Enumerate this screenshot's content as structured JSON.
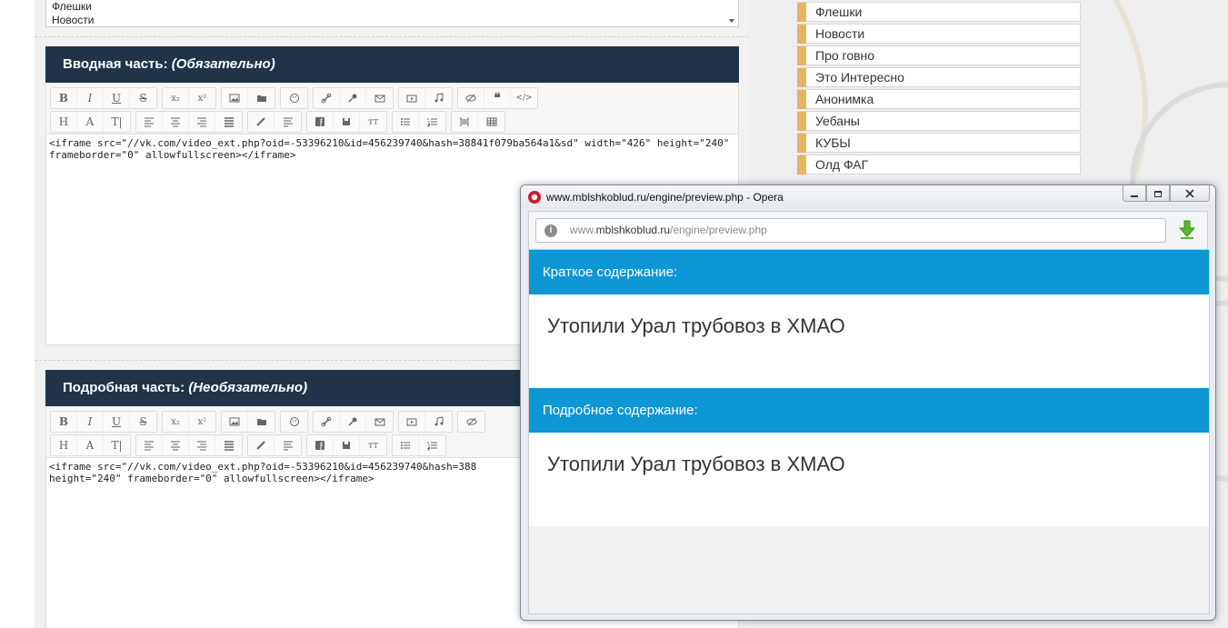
{
  "top_select": {
    "options": [
      "Флешки",
      "Новости"
    ]
  },
  "section_intro": {
    "title": "Вводная часть:",
    "required": "(Обязательно)",
    "editor_text": "<iframe src=\"//vk.com/video_ext.php?oid=-53396210&id=456239740&hash=38841f079ba564a1&sd\" width=\"426\" height=\"240\" frameborder=\"0\" allowfullscreen></iframe>"
  },
  "section_detail": {
    "title": "Подробная часть:",
    "required": "(Необязательно)",
    "editor_text": "<iframe src=\"//vk.com/video_ext.php?oid=-53396210&id=456239740&hash=388\nheight=\"240\" frameborder=\"0\" allowfullscreen></iframe>"
  },
  "toolbar": {
    "row1": [
      "B",
      "I",
      "U",
      "S",
      "x₂",
      "x²",
      "image",
      "folder",
      "smile",
      "link",
      "key",
      "mail",
      "video",
      "audio",
      "hide",
      "quote",
      "code"
    ],
    "row2": [
      "H",
      "A",
      "T",
      "align-left",
      "align-center",
      "align-right",
      "align-justify",
      "pen",
      "list-lines",
      "facebook",
      "save",
      "font-size",
      "ul",
      "ol",
      "page-break",
      "table"
    ]
  },
  "sidebar": {
    "items": [
      "Флешки",
      "Новости",
      "Про говно",
      "Это Интересно",
      "Анонимка",
      "Уебаны",
      "КУБЫ",
      "Олд ФАГ"
    ]
  },
  "popup": {
    "window_title": "www.mblshkoblud.ru/engine/preview.php - Opera",
    "url_prefix": "www.",
    "url_domain": "mblshkoblud.ru",
    "url_path": "/engine/preview.php",
    "short_heading": "Краткое содержание:",
    "short_body": "Утопили Урал трубовоз в ХМАО",
    "full_heading": "Подробное содержание:",
    "full_body": "Утопили Урал трубовоз в ХМАО",
    "colors": {
      "header_blue": "#0f96d5",
      "opera_red": "#cc1b2a"
    }
  }
}
